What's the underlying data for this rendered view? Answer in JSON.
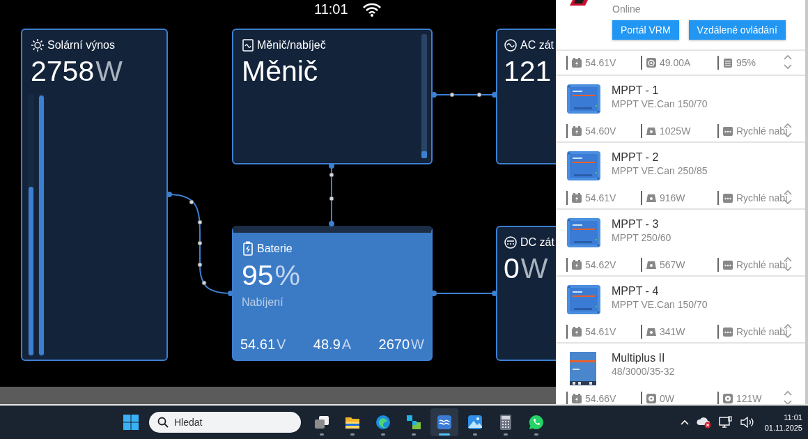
{
  "status_bar": {
    "time": "11:01"
  },
  "solar": {
    "title": "Solární výnos",
    "value": "2758",
    "unit": "W",
    "meters": [
      {
        "level": 0.65
      },
      {
        "level": 1
      }
    ]
  },
  "inverter": {
    "title": "Měnič/nabíječ",
    "state": "Měnič"
  },
  "ac_loads": {
    "title": "AC zát",
    "value": "121"
  },
  "battery": {
    "title": "Baterie",
    "value": "95",
    "unit": "%",
    "state": "Nabíjení",
    "stats": [
      {
        "value": "54.61",
        "unit": "V"
      },
      {
        "value": "48.9",
        "unit": "A"
      },
      {
        "value": "2670",
        "unit": "W"
      }
    ]
  },
  "dc_loads": {
    "title": "DC zát",
    "value": "0",
    "unit": "W"
  },
  "device_panel": {
    "status": "Online",
    "buttons": [
      "Portál VRM",
      "Vzdálené ovládání"
    ],
    "summary_metrics": [
      {
        "kind": "voltage",
        "text": "54.61V"
      },
      {
        "kind": "current",
        "text": "49.00A"
      },
      {
        "kind": "soc",
        "text": "95%"
      }
    ],
    "devices": [
      {
        "kind": "mppt",
        "name": "MPPT - 1",
        "model": "MPPT VE.Can 150/70",
        "metrics": [
          {
            "kind": "voltage",
            "text": "54.60V"
          },
          {
            "kind": "power",
            "text": "1025W"
          },
          {
            "kind": "state",
            "text": "Rychlé nabí"
          }
        ]
      },
      {
        "kind": "mppt",
        "name": "MPPT - 2",
        "model": "MPPT VE.Can 250/85",
        "metrics": [
          {
            "kind": "voltage",
            "text": "54.61V"
          },
          {
            "kind": "power",
            "text": "916W"
          },
          {
            "kind": "state",
            "text": "Rychlé nabí"
          }
        ]
      },
      {
        "kind": "mppt",
        "name": "MPPT - 3",
        "model": "MPPT 250/60",
        "metrics": [
          {
            "kind": "voltage",
            "text": "54.62V"
          },
          {
            "kind": "power",
            "text": "567W"
          },
          {
            "kind": "state",
            "text": "Rychlé nabí"
          }
        ]
      },
      {
        "kind": "mppt",
        "name": "MPPT - 4",
        "model": "MPPT VE.Can 150/70",
        "metrics": [
          {
            "kind": "voltage",
            "text": "54.61V"
          },
          {
            "kind": "power",
            "text": "341W"
          },
          {
            "kind": "state",
            "text": "Rychlé nabí"
          }
        ]
      },
      {
        "kind": "multiplus",
        "name": "Multiplus II",
        "model": "48/3000/35-32",
        "metrics": [
          {
            "kind": "voltage",
            "text": "54.66V"
          },
          {
            "kind": "ac",
            "text": "0W"
          },
          {
            "kind": "ac",
            "text": "121W"
          }
        ]
      }
    ]
  },
  "taskbar": {
    "search": {
      "placeholder": "Hledat"
    },
    "apps": [
      {
        "kind": "task-view",
        "selected": false
      },
      {
        "kind": "folder",
        "selected": false
      },
      {
        "kind": "browser",
        "selected": false
      },
      {
        "kind": "blocks",
        "selected": false
      },
      {
        "kind": "victron",
        "selected": true
      },
      {
        "kind": "photos",
        "selected": false
      },
      {
        "kind": "calculator",
        "selected": false
      },
      {
        "kind": "chat",
        "selected": false
      }
    ],
    "time": "11:01",
    "date": "01.11.2025"
  }
}
